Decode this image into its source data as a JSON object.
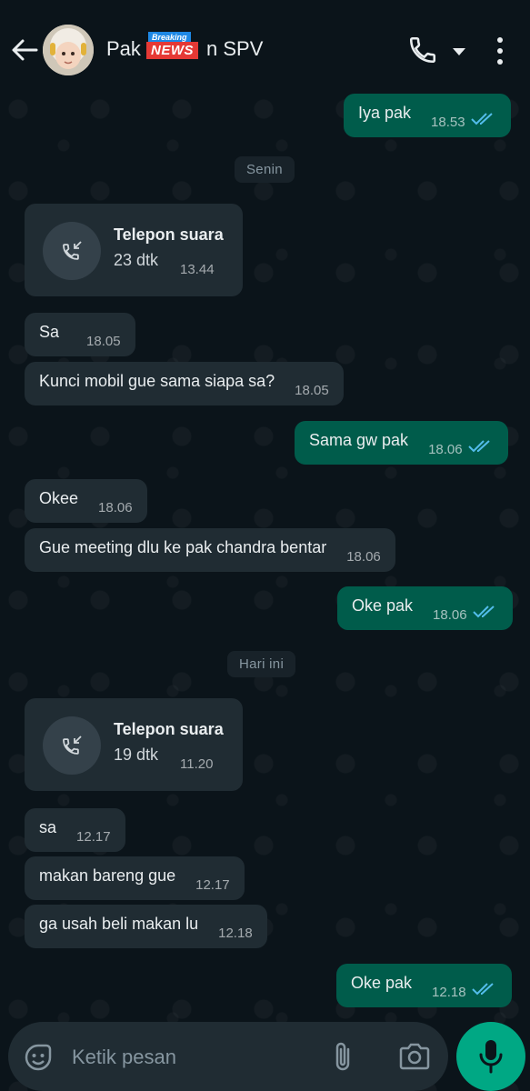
{
  "header": {
    "title_prefix": "Pak",
    "title_suffix": "n SPV",
    "logo_breaking": "Breaking",
    "logo_news": "NEWS"
  },
  "messages": [
    {
      "type": "out",
      "text": "Iya pak",
      "time": "18.53",
      "status": "read"
    },
    {
      "type": "date",
      "text": "Senin"
    },
    {
      "type": "call",
      "title": "Telepon suara",
      "duration": "23 dtk",
      "time": "13.44"
    },
    {
      "type": "in",
      "text": "Sa",
      "time": "18.05"
    },
    {
      "type": "in",
      "text": "Kunci mobil gue sama siapa sa?",
      "time": "18.05"
    },
    {
      "type": "out",
      "text": "Sama gw pak",
      "time": "18.06",
      "status": "read"
    },
    {
      "type": "in",
      "text": "Okee",
      "time": "18.06"
    },
    {
      "type": "in",
      "text": "Gue meeting dlu ke pak chandra bentar",
      "time": "18.06"
    },
    {
      "type": "out",
      "text": "Oke pak",
      "time": "18.06",
      "status": "read"
    },
    {
      "type": "date",
      "text": "Hari ini"
    },
    {
      "type": "call",
      "title": "Telepon suara",
      "duration": "19 dtk",
      "time": "11.20"
    },
    {
      "type": "in",
      "text": "sa",
      "time": "12.17"
    },
    {
      "type": "in",
      "text": "makan bareng gue",
      "time": "12.17"
    },
    {
      "type": "in",
      "text": "ga usah beli makan lu",
      "time": "12.18"
    },
    {
      "type": "out",
      "text": "Oke pak",
      "time": "12.18",
      "status": "read"
    }
  ],
  "composer": {
    "placeholder": "Ketik pesan"
  },
  "colors": {
    "background": "#0b141a",
    "incoming_bubble": "#202c33",
    "outgoing_bubble": "#005c4b",
    "read_ticks": "#53bdeb",
    "mic_button": "#00a884"
  },
  "icons": {
    "back": "back-arrow-icon",
    "call": "phone-icon",
    "dropdown": "caret-down-icon",
    "menu": "more-vertical-icon",
    "incoming_call": "incoming-call-icon",
    "emoji": "emoji-sticker-icon",
    "attach": "paperclip-icon",
    "camera": "camera-icon",
    "mic": "microphone-icon"
  }
}
